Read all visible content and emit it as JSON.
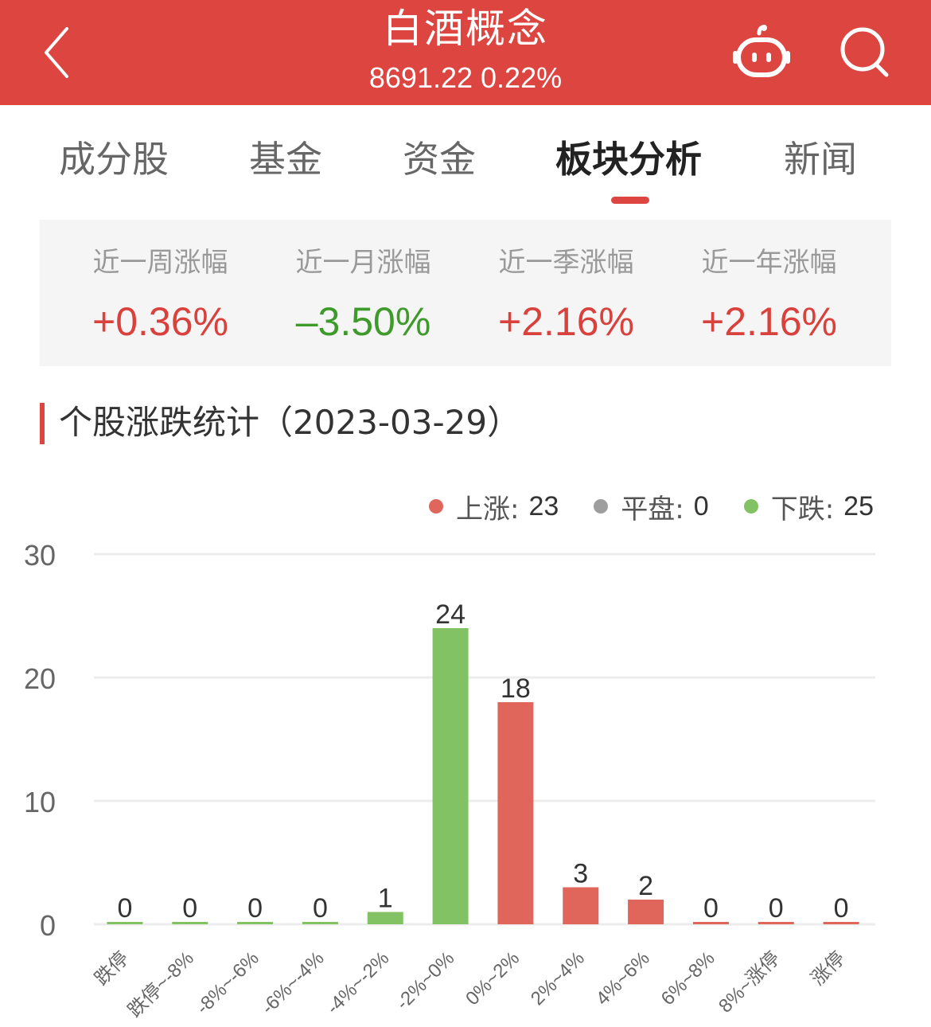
{
  "header": {
    "title": "白酒概念",
    "index_value": "8691.22",
    "change_pct": "0.22%",
    "subtitle": "8691.22 0.22%",
    "icons": [
      "back-chevron-icon",
      "robot-assistant-icon",
      "search-icon"
    ]
  },
  "tabs": [
    {
      "label": "成分股",
      "active": false
    },
    {
      "label": "基金",
      "active": false
    },
    {
      "label": "资金",
      "active": false
    },
    {
      "label": "板块分析",
      "active": true
    },
    {
      "label": "新闻",
      "active": false
    }
  ],
  "performance": [
    {
      "label": "近一周涨幅",
      "value": "+0.36%",
      "direction": "up"
    },
    {
      "label": "近一月涨幅",
      "value": "–3.50%",
      "direction": "down"
    },
    {
      "label": "近一季涨幅",
      "value": "+2.16%",
      "direction": "up"
    },
    {
      "label": "近一年涨幅",
      "value": "+2.16%",
      "direction": "up"
    }
  ],
  "section": {
    "title": "个股涨跌统计（2023-03-29）"
  },
  "legend": [
    {
      "label": "上涨:",
      "value": "23",
      "color": "#e0665c"
    },
    {
      "label": "平盘:",
      "value": "0",
      "color": "#9e9e9e"
    },
    {
      "label": "下跌:",
      "value": "25",
      "color": "#82c265"
    }
  ],
  "colors": {
    "brand_red": "#dd4540",
    "up": "#d9413c",
    "down": "#3f9a2c",
    "bar_up": "#e0665c",
    "bar_down": "#82c265",
    "bar_flat": "#9e9e9e"
  },
  "chart_data": {
    "type": "bar",
    "title": "个股涨跌统计（2023-03-29）",
    "xlabel": "",
    "ylabel": "",
    "categories": [
      "跌停",
      "跌停~-8%",
      "-8%~-6%",
      "-6%~-4%",
      "-4%~-2%",
      "-2%~0%",
      "0%~2%",
      "2%~4%",
      "4%~6%",
      "6%~8%",
      "8%~涨停",
      "涨停"
    ],
    "values": [
      0,
      0,
      0,
      0,
      1,
      24,
      18,
      3,
      2,
      0,
      0,
      0
    ],
    "series_side": [
      "down",
      "down",
      "down",
      "down",
      "down",
      "down",
      "up",
      "up",
      "up",
      "up",
      "up",
      "up"
    ],
    "ylim": [
      0,
      30
    ],
    "yticks": [
      0,
      10,
      20,
      30
    ],
    "grid": true,
    "legend_position": "top-right",
    "data_labels": true
  }
}
